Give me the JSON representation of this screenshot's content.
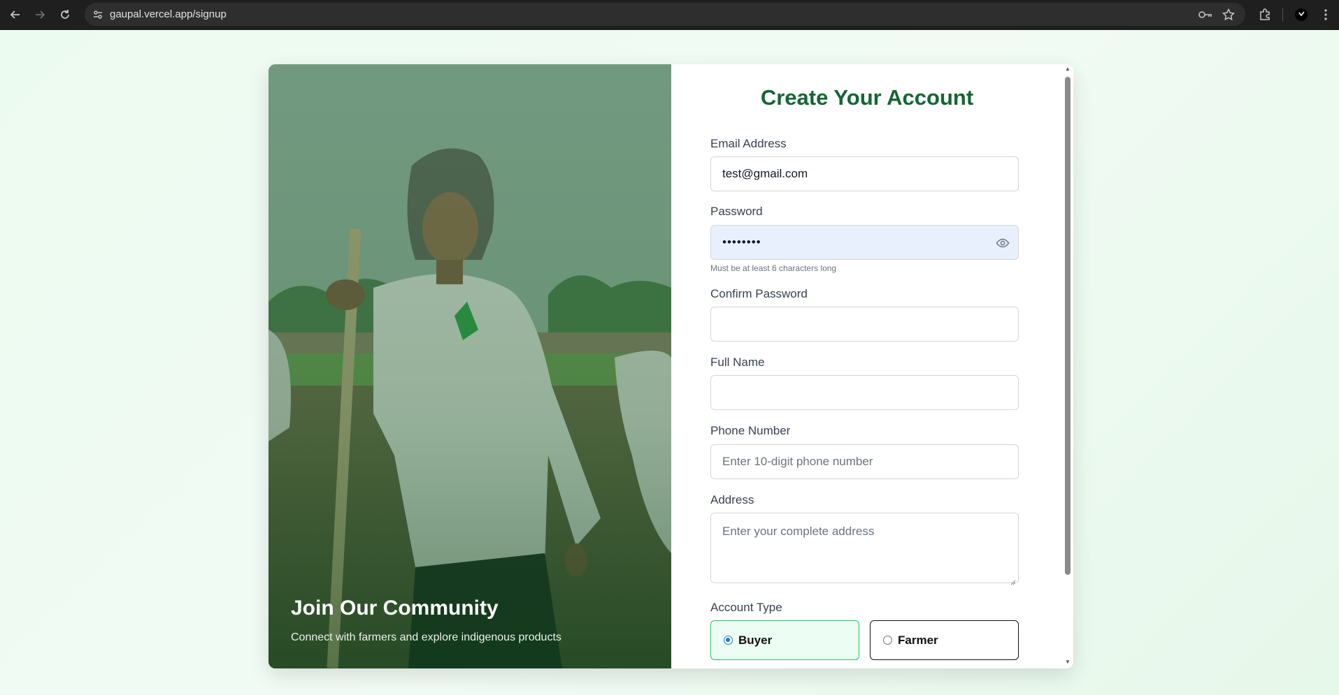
{
  "browser": {
    "url": "gaupal.vercel.app/signup",
    "icons": [
      "back-icon",
      "forward-icon",
      "reload-icon",
      "site-settings-icon",
      "password-key-icon",
      "bookmark-star-icon",
      "extensions-icon",
      "profile-icon",
      "menu-icon"
    ]
  },
  "hero": {
    "title": "Join Our Community",
    "subtitle": "Connect with farmers and explore indigenous products"
  },
  "form": {
    "title": "Create Your Account",
    "email": {
      "label": "Email Address",
      "value": "test@gmail.com"
    },
    "password": {
      "label": "Password",
      "value": "••••••••",
      "hint": "Must be at least 6 characters long"
    },
    "confirm_password": {
      "label": "Confirm Password",
      "value": ""
    },
    "full_name": {
      "label": "Full Name",
      "value": ""
    },
    "phone": {
      "label": "Phone Number",
      "placeholder": "Enter 10-digit phone number"
    },
    "address": {
      "label": "Address",
      "placeholder": "Enter your complete address"
    },
    "account_type": {
      "label": "Account Type",
      "options": [
        {
          "label": "Buyer",
          "selected": true
        },
        {
          "label": "Farmer",
          "selected": false
        }
      ]
    }
  },
  "colors": {
    "accent": "#166534",
    "selected_border": "#22c55e",
    "selected_bg": "#ecfdf3",
    "autofill_bg": "#e8f0fe"
  }
}
